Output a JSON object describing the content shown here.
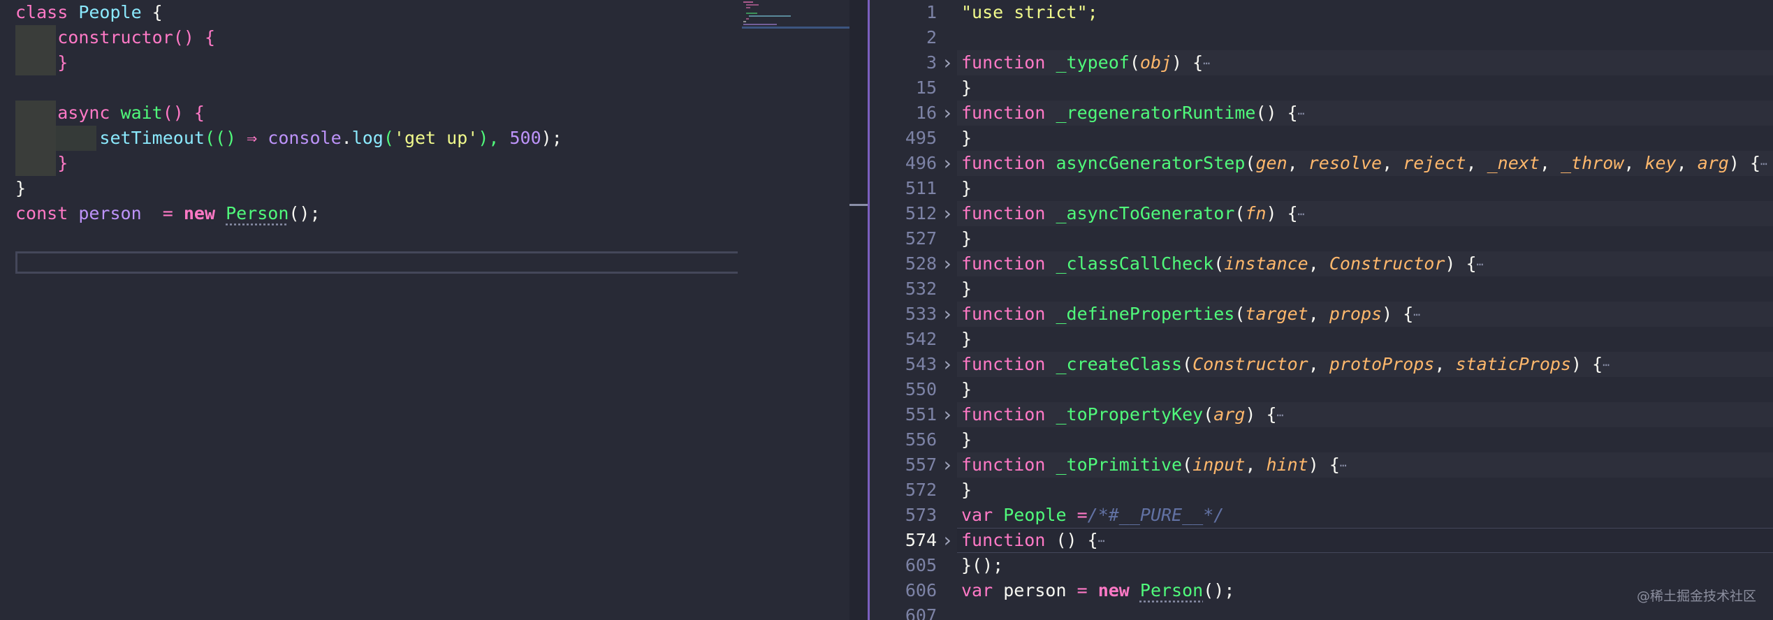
{
  "left_editor": {
    "lines": [
      {
        "parts": [
          {
            "t": "class ",
            "c": "kw"
          },
          {
            "t": "People",
            "c": "cls"
          },
          {
            "t": " {",
            "c": "var"
          }
        ]
      },
      {
        "parts": [
          {
            "t": "    "
          },
          {
            "t": "constructor",
            "c": "kw"
          },
          {
            "t": "() {",
            "c": "kw"
          }
        ]
      },
      {
        "parts": [
          {
            "t": "    "
          },
          {
            "t": "}",
            "c": "kw"
          }
        ]
      },
      {
        "parts": []
      },
      {
        "parts": [
          {
            "t": "    "
          },
          {
            "t": "async ",
            "c": "kw"
          },
          {
            "t": "wait",
            "c": "fn"
          },
          {
            "t": "() {",
            "c": "kw"
          }
        ]
      },
      {
        "parts": [
          {
            "t": "        "
          },
          {
            "t": "setTimeout",
            "c": "cls"
          },
          {
            "t": "(() ",
            "c": "fn"
          },
          {
            "t": "⇒ ",
            "c": "kw"
          },
          {
            "t": "console",
            "c": "num"
          },
          {
            "t": ".",
            "c": "var"
          },
          {
            "t": "log",
            "c": "cls"
          },
          {
            "t": "(",
            "c": "fn"
          },
          {
            "t": "'get up'",
            "c": "str"
          },
          {
            "t": "), ",
            "c": "fn"
          },
          {
            "t": "500",
            "c": "num"
          },
          {
            "t": ");",
            "c": "var"
          }
        ]
      },
      {
        "parts": [
          {
            "t": "    "
          },
          {
            "t": "}",
            "c": "kw"
          }
        ]
      },
      {
        "parts": [
          {
            "t": "}",
            "c": "var"
          }
        ]
      },
      {
        "parts": [
          {
            "t": "const ",
            "c": "kw"
          },
          {
            "t": "person  ",
            "c": "num"
          },
          {
            "t": "= ",
            "c": "kw"
          },
          {
            "t": "new ",
            "c": "kwb"
          },
          {
            "t": "Person",
            "c": "fn",
            "d": true
          },
          {
            "t": "();",
            "c": "var"
          }
        ]
      }
    ]
  },
  "right_editor": {
    "lines": [
      {
        "n": "1",
        "fold": false,
        "parts": [
          {
            "t": "\"use strict\";",
            "c": "str"
          }
        ]
      },
      {
        "n": "2",
        "fold": false,
        "parts": []
      },
      {
        "n": "3",
        "fold": true,
        "parts": [
          {
            "t": "function ",
            "c": "kw"
          },
          {
            "t": "_typeof",
            "c": "fn"
          },
          {
            "t": "(",
            "c": "var"
          },
          {
            "t": "obj",
            "c": "prm"
          },
          {
            "t": ") {",
            "c": "var"
          },
          {
            "t": "⋯",
            "c": "ellip"
          }
        ]
      },
      {
        "n": "15",
        "fold": false,
        "parts": [
          {
            "t": "}",
            "c": "var"
          }
        ]
      },
      {
        "n": "16",
        "fold": true,
        "parts": [
          {
            "t": "function ",
            "c": "kw"
          },
          {
            "t": "_regeneratorRuntime",
            "c": "fn"
          },
          {
            "t": "() {",
            "c": "var"
          },
          {
            "t": "⋯",
            "c": "ellip"
          }
        ]
      },
      {
        "n": "495",
        "fold": false,
        "parts": [
          {
            "t": "}",
            "c": "var"
          }
        ]
      },
      {
        "n": "496",
        "fold": true,
        "parts": [
          {
            "t": "function ",
            "c": "kw"
          },
          {
            "t": "asyncGeneratorStep",
            "c": "fn"
          },
          {
            "t": "(",
            "c": "var"
          },
          {
            "t": "gen",
            "c": "prm"
          },
          {
            "t": ", ",
            "c": "var"
          },
          {
            "t": "resolve",
            "c": "prm"
          },
          {
            "t": ", ",
            "c": "var"
          },
          {
            "t": "reject",
            "c": "prm"
          },
          {
            "t": ", ",
            "c": "var"
          },
          {
            "t": "_next",
            "c": "prm"
          },
          {
            "t": ", ",
            "c": "var"
          },
          {
            "t": "_throw",
            "c": "prm"
          },
          {
            "t": ", ",
            "c": "var"
          },
          {
            "t": "key",
            "c": "prm"
          },
          {
            "t": ", ",
            "c": "var"
          },
          {
            "t": "arg",
            "c": "prm"
          },
          {
            "t": ") {",
            "c": "var"
          },
          {
            "t": "⋯",
            "c": "ellip"
          }
        ]
      },
      {
        "n": "511",
        "fold": false,
        "parts": [
          {
            "t": "}",
            "c": "var"
          }
        ]
      },
      {
        "n": "512",
        "fold": true,
        "parts": [
          {
            "t": "function ",
            "c": "kw"
          },
          {
            "t": "_asyncToGenerator",
            "c": "fn"
          },
          {
            "t": "(",
            "c": "var"
          },
          {
            "t": "fn",
            "c": "prm"
          },
          {
            "t": ") {",
            "c": "var"
          },
          {
            "t": "⋯",
            "c": "ellip"
          }
        ]
      },
      {
        "n": "527",
        "fold": false,
        "parts": [
          {
            "t": "}",
            "c": "var"
          }
        ]
      },
      {
        "n": "528",
        "fold": true,
        "parts": [
          {
            "t": "function ",
            "c": "kw"
          },
          {
            "t": "_classCallCheck",
            "c": "fn"
          },
          {
            "t": "(",
            "c": "var"
          },
          {
            "t": "instance",
            "c": "prm"
          },
          {
            "t": ", ",
            "c": "var"
          },
          {
            "t": "Constructor",
            "c": "prm"
          },
          {
            "t": ") {",
            "c": "var"
          },
          {
            "t": "⋯",
            "c": "ellip"
          }
        ]
      },
      {
        "n": "532",
        "fold": false,
        "parts": [
          {
            "t": "}",
            "c": "var"
          }
        ]
      },
      {
        "n": "533",
        "fold": true,
        "parts": [
          {
            "t": "function ",
            "c": "kw"
          },
          {
            "t": "_defineProperties",
            "c": "fn"
          },
          {
            "t": "(",
            "c": "var"
          },
          {
            "t": "target",
            "c": "prm"
          },
          {
            "t": ", ",
            "c": "var"
          },
          {
            "t": "props",
            "c": "prm"
          },
          {
            "t": ") {",
            "c": "var"
          },
          {
            "t": "⋯",
            "c": "ellip"
          }
        ]
      },
      {
        "n": "542",
        "fold": false,
        "parts": [
          {
            "t": "}",
            "c": "var"
          }
        ]
      },
      {
        "n": "543",
        "fold": true,
        "parts": [
          {
            "t": "function ",
            "c": "kw"
          },
          {
            "t": "_createClass",
            "c": "fn"
          },
          {
            "t": "(",
            "c": "var"
          },
          {
            "t": "Constructor",
            "c": "prm"
          },
          {
            "t": ", ",
            "c": "var"
          },
          {
            "t": "protoProps",
            "c": "prm"
          },
          {
            "t": ", ",
            "c": "var"
          },
          {
            "t": "staticProps",
            "c": "prm"
          },
          {
            "t": ") {",
            "c": "var"
          },
          {
            "t": "⋯",
            "c": "ellip"
          }
        ]
      },
      {
        "n": "550",
        "fold": false,
        "parts": [
          {
            "t": "}",
            "c": "var"
          }
        ]
      },
      {
        "n": "551",
        "fold": true,
        "parts": [
          {
            "t": "function ",
            "c": "kw"
          },
          {
            "t": "_toPropertyKey",
            "c": "fn"
          },
          {
            "t": "(",
            "c": "var"
          },
          {
            "t": "arg",
            "c": "prm"
          },
          {
            "t": ") {",
            "c": "var"
          },
          {
            "t": "⋯",
            "c": "ellip"
          }
        ]
      },
      {
        "n": "556",
        "fold": false,
        "parts": [
          {
            "t": "}",
            "c": "var"
          }
        ]
      },
      {
        "n": "557",
        "fold": true,
        "parts": [
          {
            "t": "function ",
            "c": "kw"
          },
          {
            "t": "_toPrimitive",
            "c": "fn"
          },
          {
            "t": "(",
            "c": "var"
          },
          {
            "t": "input",
            "c": "prm"
          },
          {
            "t": ", ",
            "c": "var"
          },
          {
            "t": "hint",
            "c": "prm"
          },
          {
            "t": ") {",
            "c": "var"
          },
          {
            "t": "⋯",
            "c": "ellip"
          }
        ]
      },
      {
        "n": "572",
        "fold": false,
        "parts": [
          {
            "t": "}",
            "c": "var"
          }
        ]
      },
      {
        "n": "573",
        "fold": false,
        "parts": [
          {
            "t": "var ",
            "c": "kw"
          },
          {
            "t": "People ",
            "c": "fn"
          },
          {
            "t": "=",
            "c": "kw"
          },
          {
            "t": "/*#__PURE__*/",
            "c": "cmt"
          }
        ]
      },
      {
        "n": "574",
        "fold": true,
        "active": true,
        "parts": [
          {
            "t": "function ",
            "c": "kw"
          },
          {
            "t": "() {",
            "c": "var"
          },
          {
            "t": "⋯",
            "c": "ellip"
          }
        ]
      },
      {
        "n": "605",
        "fold": false,
        "parts": [
          {
            "t": "}();",
            "c": "var"
          }
        ]
      },
      {
        "n": "606",
        "fold": false,
        "parts": [
          {
            "t": "var ",
            "c": "kw"
          },
          {
            "t": "person ",
            "c": "var"
          },
          {
            "t": "= ",
            "c": "kw"
          },
          {
            "t": "new ",
            "c": "kwb"
          },
          {
            "t": "Person",
            "c": "fn",
            "d": true
          },
          {
            "t": "();",
            "c": "var"
          }
        ]
      },
      {
        "n": "607",
        "fold": false,
        "parts": []
      }
    ]
  },
  "watermark": "@稀土掘金技术社区"
}
